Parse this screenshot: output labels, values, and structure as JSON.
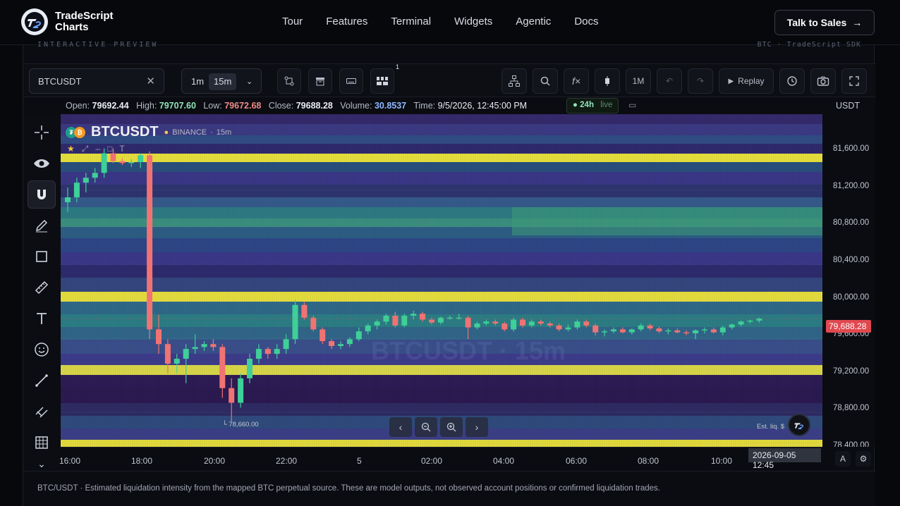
{
  "nav": {
    "brand_line1": "TradeScript",
    "brand_line2": "Charts",
    "links": [
      "Tour",
      "Features",
      "Terminal",
      "Widgets",
      "Agentic",
      "Docs"
    ],
    "cta": "Talk to Sales"
  },
  "preview": {
    "label": "INTERACTIVE PREVIEW",
    "right_label": "BTC · TradeScript SDK"
  },
  "toolbar": {
    "symbol_value": "BTCUSDT",
    "timeframes": [
      "1m",
      "15m"
    ],
    "active_timeframe": "15m",
    "badge_count": "1",
    "range_label": "1M",
    "replay_label": "Replay"
  },
  "ohlc": {
    "open_label": "Open:",
    "open": "79692.44",
    "high_label": "High:",
    "high": "79707.60",
    "low_label": "Low:",
    "low": "79672.68",
    "close_label": "Close:",
    "close": "79688.28",
    "volume_label": "Volume:",
    "volume": "30.8537",
    "time_label": "Time:",
    "time": "9/5/2026, 12:45:00 PM",
    "live_range": "24h",
    "live_label": "live",
    "currency": "USDT"
  },
  "chart_header": {
    "symbol": "BTCUSDT",
    "exchange": "BINANCE",
    "interval": "15m",
    "watermark": "BTCUSDT · 15m",
    "low_marker": "78,660.00",
    "est_label": "Est. liq. $"
  },
  "yaxis_labels": [
    "81,600.00",
    "81,200.00",
    "80,800.00",
    "80,400.00",
    "80,000.00",
    "79,600.00",
    "79,200.00",
    "78,800.00",
    "78,400.00"
  ],
  "last_price": "79,688.28",
  "xaxis_labels": [
    "16:00",
    "18:00",
    "20:00",
    "22:00",
    "5",
    "02:00",
    "04:00",
    "06:00",
    "08:00",
    "10:00"
  ],
  "crosshair_date": "2026-09-05 12:45",
  "footer_text": "BTC/USDT · Estimated liquidation intensity from the mapped BTC perpetual source. These are model outputs, not observed account positions or confirmed liquidation trades.",
  "colors": {
    "up": "#3fcf98",
    "down": "#f07373",
    "heat_high": "#e8e04a",
    "heat_low": "#2a1b52",
    "price_tag": "#e0484f"
  },
  "chart_data": {
    "type": "candlestick",
    "interval": "15m",
    "ylim": [
      78400,
      81800
    ],
    "candles": [
      [
        80900,
        81050,
        80800,
        80950
      ],
      [
        80950,
        81150,
        80900,
        81100
      ],
      [
        81100,
        81200,
        81000,
        81150
      ],
      [
        81150,
        81250,
        81100,
        81200
      ],
      [
        81200,
        81450,
        81150,
        81400
      ],
      [
        81400,
        81450,
        81300,
        81320
      ],
      [
        81320,
        81350,
        81280,
        81300
      ],
      [
        81300,
        81340,
        81260,
        81310
      ],
      [
        81310,
        81400,
        81250,
        81380
      ],
      [
        81380,
        81420,
        79500,
        79600
      ],
      [
        79600,
        79750,
        79350,
        79450
      ],
      [
        79450,
        79500,
        79150,
        79250
      ],
      [
        79250,
        79350,
        79150,
        79300
      ],
      [
        79300,
        79450,
        79050,
        79400
      ],
      [
        79400,
        79550,
        79350,
        79420
      ],
      [
        79420,
        79480,
        79380,
        79450
      ],
      [
        79450,
        79500,
        79380,
        79420
      ],
      [
        79420,
        79450,
        78900,
        79000
      ],
      [
        79000,
        79100,
        78660,
        78850
      ],
      [
        78850,
        79150,
        78800,
        79100
      ],
      [
        79100,
        79350,
        79050,
        79300
      ],
      [
        79300,
        79450,
        79250,
        79400
      ],
      [
        79400,
        79420,
        79300,
        79350
      ],
      [
        79350,
        79450,
        79300,
        79400
      ],
      [
        79400,
        79550,
        79350,
        79500
      ],
      [
        79500,
        79900,
        79450,
        79850
      ],
      [
        79850,
        79880,
        79700,
        79720
      ],
      [
        79720,
        79740,
        79580,
        79600
      ],
      [
        79600,
        79620,
        79450,
        79480
      ],
      [
        79480,
        79500,
        79400,
        79430
      ],
      [
        79430,
        79480,
        79400,
        79450
      ],
      [
        79450,
        79520,
        79420,
        79500
      ],
      [
        79500,
        79620,
        79480,
        79580
      ],
      [
        79580,
        79660,
        79550,
        79640
      ],
      [
        79640,
        79700,
        79600,
        79680
      ],
      [
        79680,
        79760,
        79650,
        79740
      ],
      [
        79740,
        79780,
        79620,
        79640
      ],
      [
        79640,
        79760,
        79620,
        79740
      ],
      [
        79740,
        79790,
        79700,
        79760
      ],
      [
        79760,
        79780,
        79680,
        79700
      ],
      [
        79700,
        79720,
        79650,
        79670
      ],
      [
        79670,
        79730,
        79650,
        79720
      ],
      [
        79720,
        79740,
        79700,
        79720
      ],
      [
        79720,
        79760,
        79700,
        79720
      ],
      [
        79720,
        79740,
        79500,
        79620
      ],
      [
        79620,
        79680,
        79600,
        79660
      ],
      [
        79660,
        79700,
        79640,
        79680
      ],
      [
        79680,
        79700,
        79640,
        79660
      ],
      [
        79660,
        79680,
        79580,
        79600
      ],
      [
        79600,
        79720,
        79580,
        79700
      ],
      [
        79700,
        79720,
        79620,
        79640
      ],
      [
        79640,
        79700,
        79620,
        79680
      ],
      [
        79680,
        79700,
        79640,
        79660
      ],
      [
        79660,
        79680,
        79620,
        79640
      ],
      [
        79640,
        79660,
        79580,
        79600
      ],
      [
        79600,
        79650,
        79580,
        79620
      ],
      [
        79620,
        79700,
        79600,
        79680
      ],
      [
        79680,
        79700,
        79620,
        79640
      ],
      [
        79640,
        79660,
        79540,
        79570
      ],
      [
        79570,
        79600,
        79530,
        79580
      ],
      [
        79580,
        79620,
        79560,
        79600
      ],
      [
        79600,
        79620,
        79560,
        79570
      ],
      [
        79570,
        79610,
        79550,
        79600
      ],
      [
        79600,
        79660,
        79580,
        79640
      ],
      [
        79640,
        79660,
        79590,
        79610
      ],
      [
        79610,
        79630,
        79560,
        79580
      ],
      [
        79580,
        79610,
        79550,
        79590
      ],
      [
        79590,
        79610,
        79560,
        79570
      ],
      [
        79570,
        79590,
        79540,
        79560
      ],
      [
        79560,
        79600,
        79500,
        79590
      ],
      [
        79590,
        79620,
        79560,
        79600
      ],
      [
        79600,
        79620,
        79560,
        79570
      ],
      [
        79570,
        79640,
        79540,
        79620
      ],
      [
        79620,
        79660,
        79600,
        79650
      ],
      [
        79650,
        79690,
        79630,
        79680
      ],
      [
        79680,
        79700,
        79660,
        79690
      ],
      [
        79690,
        79720,
        79670,
        79710
      ]
    ]
  }
}
